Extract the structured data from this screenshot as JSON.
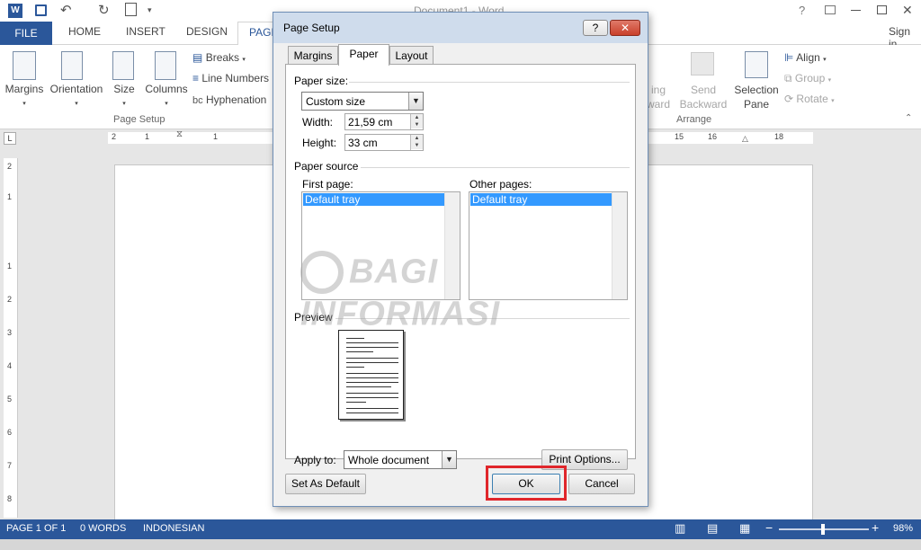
{
  "window": {
    "title": "Document1 - Word",
    "help": "?",
    "signin": "Sign in"
  },
  "tabs": [
    "FILE",
    "HOME",
    "INSERT",
    "DESIGN",
    "PAGE"
  ],
  "ribbon": {
    "margins": "Margins",
    "orientation": "Orientation",
    "size": "Size",
    "columns": "Columns",
    "breaks": "Breaks",
    "line_numbers": "Line Numbers",
    "hyphenation": "Hyphenation",
    "group_page_setup": "Page Setup",
    "bring_forward_1": "ing",
    "bring_forward_2": "ward",
    "send_backward_1": "Send",
    "send_backward_2": "Backward",
    "selection_pane_1": "Selection",
    "selection_pane_2": "Pane",
    "align": "Align",
    "group": "Group",
    "rotate": "Rotate",
    "group_arrange": "Arrange"
  },
  "ruler": {
    "left_ticks": [
      "2",
      "1",
      "1"
    ],
    "right_ticks": [
      "15",
      "16",
      "18"
    ],
    "vertical_ticks": [
      "2",
      "1",
      "1",
      "2",
      "3",
      "4",
      "5",
      "6",
      "7",
      "8"
    ]
  },
  "dialog": {
    "title": "Page Setup",
    "help_button": "?",
    "close_button": "✕",
    "tabs": [
      "Margins",
      "Paper",
      "Layout"
    ],
    "active_tab": "Paper",
    "paper_size_section": "Paper size:",
    "paper_size_value": "Custom size",
    "width_label": "Width:",
    "width_value": "21,59 cm",
    "height_label": "Height:",
    "height_value": "33 cm",
    "paper_source_section": "Paper source",
    "first_page_label": "First page:",
    "first_page_selected": "Default tray",
    "other_pages_label": "Other pages:",
    "other_pages_selected": "Default tray",
    "preview_section": "Preview",
    "apply_to_label": "Apply to:",
    "apply_to_value": "Whole document",
    "print_options": "Print Options...",
    "set_default": "Set As Default",
    "ok": "OK",
    "cancel": "Cancel"
  },
  "watermark": "BAGI INFORMASI",
  "status": {
    "page": "PAGE 1 OF 1",
    "words": "0 WORDS",
    "language": "INDONESIAN",
    "zoom": "98%",
    "zoom_level": 0.49
  },
  "colors": {
    "accent": "#2b579a",
    "highlight": "#e0262b",
    "selection": "#3399ff"
  }
}
